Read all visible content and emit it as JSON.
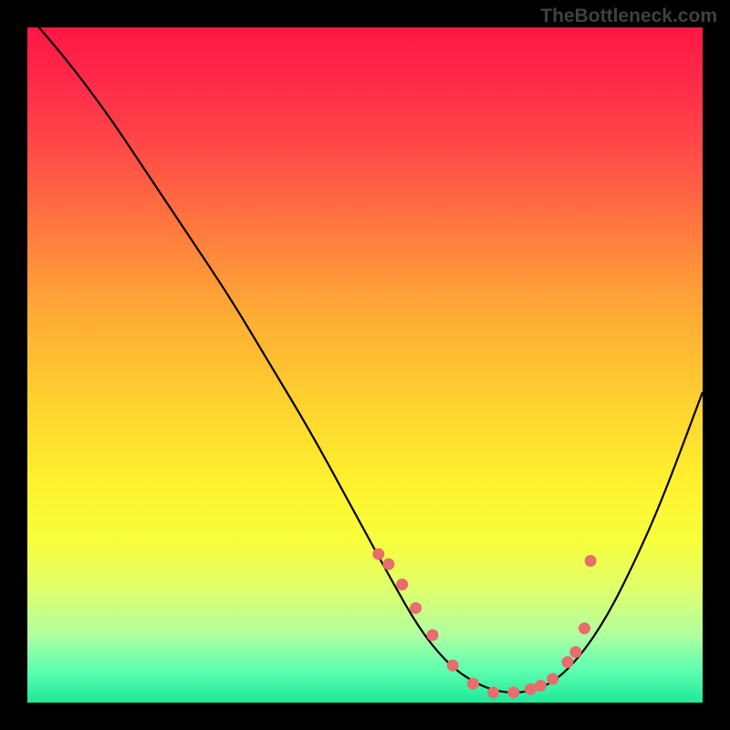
{
  "watermark": "TheBottleneck.com",
  "chart_data": {
    "type": "line",
    "title": "",
    "xlabel": "",
    "ylabel": "",
    "xlim": [
      0,
      100
    ],
    "ylim": [
      0,
      100
    ],
    "series": [
      {
        "name": "curve",
        "x": [
          0,
          6,
          12,
          18,
          24,
          30,
          36,
          42,
          48,
          54,
          58,
          62,
          66,
          70,
          74,
          78,
          82,
          86,
          90,
          94,
          100
        ],
        "y": [
          102,
          95,
          87,
          78,
          69,
          60,
          50,
          40,
          29,
          18,
          11,
          6,
          3,
          1.5,
          1.5,
          3,
          7,
          13,
          21,
          30,
          46
        ]
      }
    ],
    "markers": {
      "x_percent": [
        52.0,
        53.5,
        55.5,
        57.5,
        60.0,
        63.0,
        66.0,
        69.0,
        72.0,
        74.5,
        76.0,
        77.8,
        80.0,
        81.2,
        82.5,
        83.4
      ],
      "y_percent": [
        78.0,
        79.5,
        82.5,
        86.0,
        90.0,
        94.5,
        97.2,
        98.5,
        98.5,
        98.0,
        97.5,
        96.5,
        94.0,
        92.5,
        89.0,
        79.0
      ]
    },
    "background_gradient": [
      "#ff1744",
      "#ff7a3e",
      "#fff02e",
      "#20e89a"
    ]
  }
}
